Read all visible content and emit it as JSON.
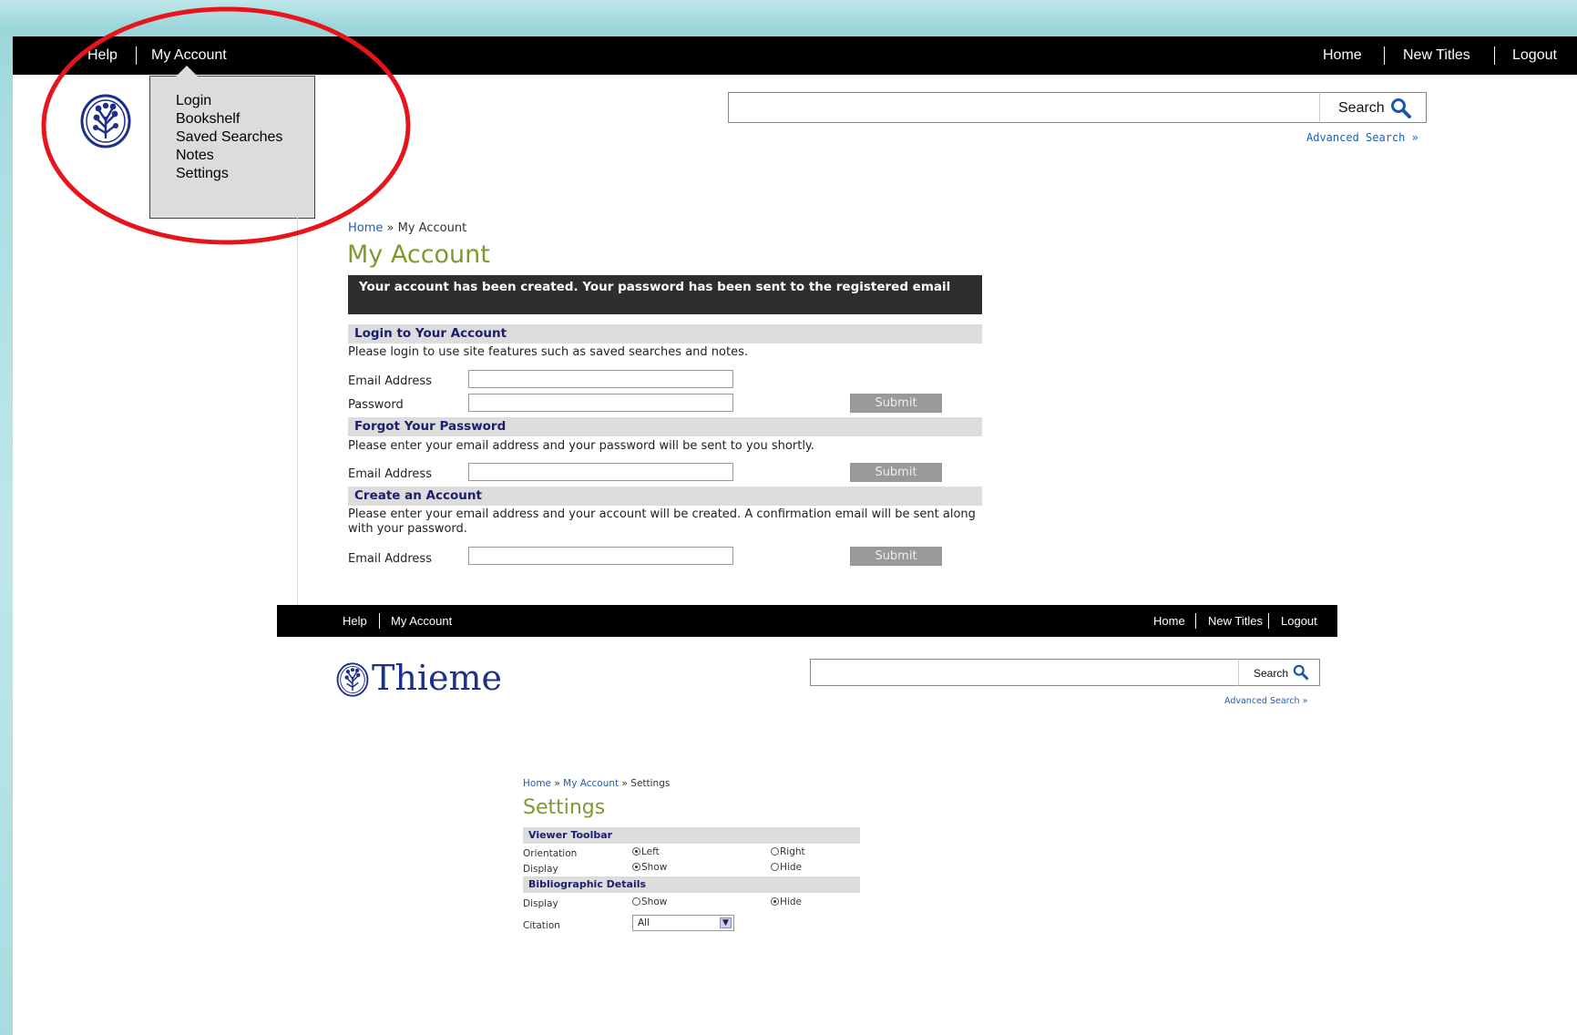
{
  "top_nav": {
    "help": "Help",
    "my_account": "My Account",
    "home": "Home",
    "new_titles": "New Titles",
    "logout": "Logout"
  },
  "my_account_menu": [
    "Login",
    "Bookshelf",
    "Saved Searches",
    "Notes",
    "Settings"
  ],
  "search": {
    "button_label": "Search",
    "placeholder": "",
    "advanced_label": "Advanced Search »"
  },
  "breadcrumb": {
    "home": "Home",
    "separator": "»",
    "current": "My Account"
  },
  "page_title": "My Account",
  "notice": "Your account has been created. Your password has been sent to the registered email",
  "login": {
    "heading": "Login to Your Account",
    "description": "Please login to use site features such as saved searches and notes.",
    "email_label": "Email Address",
    "password_label": "Password",
    "submit": "Submit"
  },
  "forgot": {
    "heading": "Forgot Your Password",
    "description": "Please enter your email address and your password will be sent to you shortly.",
    "email_label": "Email Address",
    "submit": "Submit"
  },
  "create": {
    "heading": "Create an Account",
    "description": "Please enter your email address and your account will be created. A confirmation email will be sent along with your password.",
    "email_label": "Email Address",
    "submit": "Submit"
  },
  "settings_shot": {
    "top_nav": {
      "help": "Help",
      "my_account": "My Account",
      "home": "Home",
      "new_titles": "New Titles",
      "logout": "Logout"
    },
    "logo_text": "Thieme",
    "search_label": "Search",
    "advanced_label": "Advanced Search »",
    "breadcrumb": {
      "home": "Home",
      "my_account": "My Account",
      "current": "Settings",
      "separator": "»"
    },
    "title": "Settings",
    "viewer_toolbar": {
      "heading": "Viewer Toolbar",
      "orientation_label": "Orientation",
      "orientation_left": "Left",
      "orientation_right": "Right",
      "display_label": "Display",
      "display_show": "Show",
      "display_hide": "Hide"
    },
    "bibliographic": {
      "heading": "Bibliographic Details",
      "display_label": "Display",
      "display_show": "Show",
      "display_hide": "Hide",
      "citation_label": "Citation",
      "citation_value": "All"
    }
  },
  "colors": {
    "accent_green": "#7d9a2e",
    "nav_black": "#000000",
    "link_blue": "#1d5fb3",
    "heading_navy": "#1b1e6e",
    "annotation_red": "#e8141c"
  }
}
